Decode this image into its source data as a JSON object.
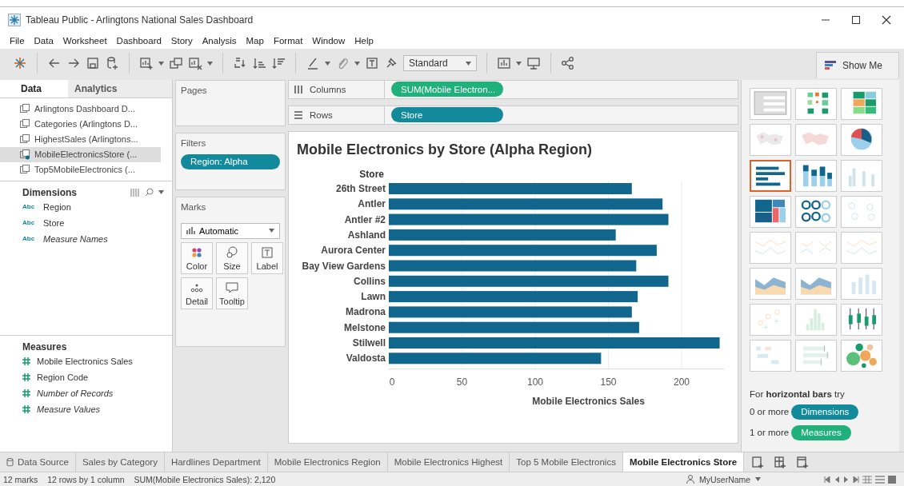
{
  "window": {
    "title": "Tableau Public - Arlingtons National Sales Dashboard"
  },
  "menu": [
    "File",
    "Data",
    "Worksheet",
    "Dashboard",
    "Story",
    "Analysis",
    "Map",
    "Format",
    "Window",
    "Help"
  ],
  "toolbar": {
    "fit": "Standard",
    "show_me": "Show Me"
  },
  "data_pane": {
    "tabs": [
      {
        "label": "Data",
        "selected": true
      },
      {
        "label": "Analytics",
        "selected": false
      }
    ],
    "sources": [
      {
        "label": "Arlingtons Dashboard D...",
        "selected": false
      },
      {
        "label": "Categories (Arlingtons D...",
        "selected": false
      },
      {
        "label": "HighestSales (Arlingtons...",
        "selected": false
      },
      {
        "label": "MobileElectronicsStore (...",
        "selected": true
      },
      {
        "label": "Top5MobileElectronics (...",
        "selected": false
      }
    ],
    "dimensions": {
      "title": "Dimensions",
      "fields": [
        {
          "type": "Abc",
          "label": "Region",
          "italic": false
        },
        {
          "type": "Abc",
          "label": "Store",
          "italic": false
        },
        {
          "type": "Abc",
          "label": "Measure Names",
          "italic": true
        }
      ]
    },
    "measures": {
      "title": "Measures",
      "fields": [
        {
          "label": "Mobile Electronics Sales",
          "italic": false
        },
        {
          "label": "Region Code",
          "italic": false
        },
        {
          "label": "Number of Records",
          "italic": true
        },
        {
          "label": "Measure Values",
          "italic": true
        }
      ]
    }
  },
  "pages": {
    "title": "Pages"
  },
  "filters": {
    "title": "Filters",
    "pills": [
      "Region: Alpha"
    ]
  },
  "marks": {
    "title": "Marks",
    "type": "Automatic",
    "buttons": [
      {
        "label": "Color",
        "kind": "color"
      },
      {
        "label": "Size",
        "kind": "size"
      },
      {
        "label": "Label",
        "kind": "label"
      },
      {
        "label": "Detail",
        "kind": "detail"
      },
      {
        "label": "Tooltip",
        "kind": "tooltip"
      }
    ]
  },
  "columns": {
    "label": "Columns",
    "pills": [
      {
        "label": "SUM(Mobile Electron...",
        "kind": "measure"
      }
    ]
  },
  "rows": {
    "label": "Rows",
    "pills": [
      {
        "label": "Store",
        "kind": "dimension"
      }
    ]
  },
  "view": {
    "title": "Mobile Electronics by Store (Alpha Region)",
    "chart_data": {
      "type": "bar",
      "orientation": "horizontal",
      "ylabel": "Store",
      "xlabel": "Mobile Electronics Sales",
      "categories": [
        "26th Street",
        "Antler",
        "Antler #2",
        "Ashland",
        "Aurora Center",
        "Bay View Gardens",
        "Collins",
        "Lawn",
        "Madrona",
        "Melstone",
        "Stilwell",
        "Valdosta"
      ],
      "grid": true,
      "series": [
        {
          "color": "#10668c",
          "values": [
            166,
            187,
            191,
            155,
            183,
            169,
            191,
            170,
            166,
            171,
            226,
            145
          ]
        }
      ],
      "xlim": [
        0,
        229
      ],
      "xticks": [
        0,
        50,
        100,
        150,
        200
      ]
    }
  },
  "show_me": {
    "thumbnails": [
      {
        "kind": "text-table",
        "enabled": true,
        "selected": false
      },
      {
        "kind": "heat-map",
        "enabled": true,
        "selected": false
      },
      {
        "kind": "highlight-table",
        "enabled": true,
        "selected": false
      },
      {
        "kind": "symbol-map",
        "enabled": false,
        "selected": false
      },
      {
        "kind": "filled-map",
        "enabled": false,
        "selected": false
      },
      {
        "kind": "pie",
        "enabled": true,
        "selected": false
      },
      {
        "kind": "hbar",
        "enabled": true,
        "selected": true
      },
      {
        "kind": "stacked-bar",
        "enabled": true,
        "selected": false
      },
      {
        "kind": "side-bar",
        "enabled": false,
        "selected": false
      },
      {
        "kind": "treemap",
        "enabled": true,
        "selected": false
      },
      {
        "kind": "circles",
        "enabled": true,
        "selected": false
      },
      {
        "kind": "side-circles",
        "enabled": false,
        "selected": false
      },
      {
        "kind": "line",
        "enabled": false,
        "selected": false
      },
      {
        "kind": "dual-line",
        "enabled": false,
        "selected": false
      },
      {
        "kind": "line",
        "enabled": false,
        "selected": false
      },
      {
        "kind": "area",
        "enabled": true,
        "selected": false
      },
      {
        "kind": "area",
        "enabled": true,
        "selected": false
      },
      {
        "kind": "combo",
        "enabled": false,
        "selected": false
      },
      {
        "kind": "scatter",
        "enabled": false,
        "selected": false
      },
      {
        "kind": "histogram",
        "enabled": false,
        "selected": false
      },
      {
        "kind": "box",
        "enabled": true,
        "selected": false
      },
      {
        "kind": "gantt",
        "enabled": false,
        "selected": false
      },
      {
        "kind": "bullet",
        "enabled": false,
        "selected": false
      },
      {
        "kind": "bubbles",
        "enabled": true,
        "selected": false
      }
    ],
    "hint": "For **horizontal bars** try",
    "requirements": [
      {
        "count": "0 or more",
        "pill": "Dimensions",
        "kind": "dimension"
      },
      {
        "count": "1 or more",
        "pill": "Measures",
        "kind": "measure"
      }
    ]
  },
  "sheet_tabs": [
    {
      "label": "Data Source",
      "kind": "data-source",
      "selected": false
    },
    {
      "label": "Sales by Category",
      "kind": "sheet",
      "selected": false
    },
    {
      "label": "Hardlines Department",
      "kind": "sheet",
      "selected": false
    },
    {
      "label": "Mobile Electronics Region",
      "kind": "sheet",
      "selected": false
    },
    {
      "label": "Mobile Electronics Highest",
      "kind": "sheet",
      "selected": false
    },
    {
      "label": "Top 5 Mobile Electronics",
      "kind": "sheet",
      "selected": false
    },
    {
      "label": "Mobile Electronics Store",
      "kind": "sheet",
      "selected": true
    }
  ],
  "status_bar": {
    "marks": "12 marks",
    "rows": "12 rows by 1 column",
    "sum": "SUM(Mobile Electronics Sales): 2,120",
    "user": "MyUserName"
  }
}
